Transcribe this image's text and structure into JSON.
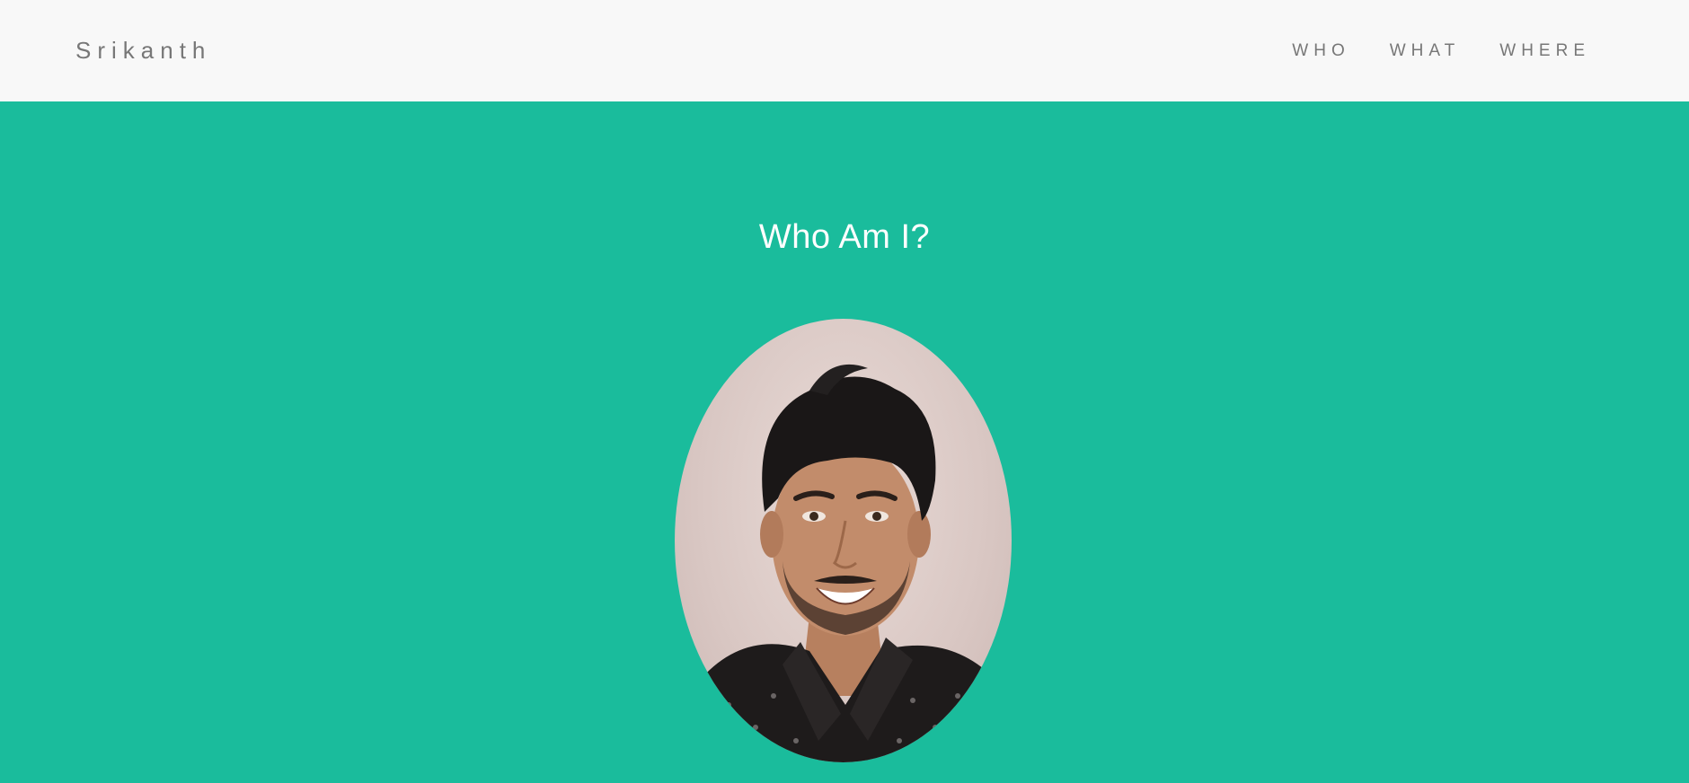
{
  "navbar": {
    "brand": "Srikanth",
    "links": [
      {
        "label": "WHO"
      },
      {
        "label": "WHAT"
      },
      {
        "label": "WHERE"
      }
    ]
  },
  "hero": {
    "title": "Who Am I?"
  },
  "colors": {
    "accent": "#1abc9c",
    "navbar_bg": "#f8f8f8",
    "nav_text": "#777777",
    "hero_text": "#ffffff"
  }
}
